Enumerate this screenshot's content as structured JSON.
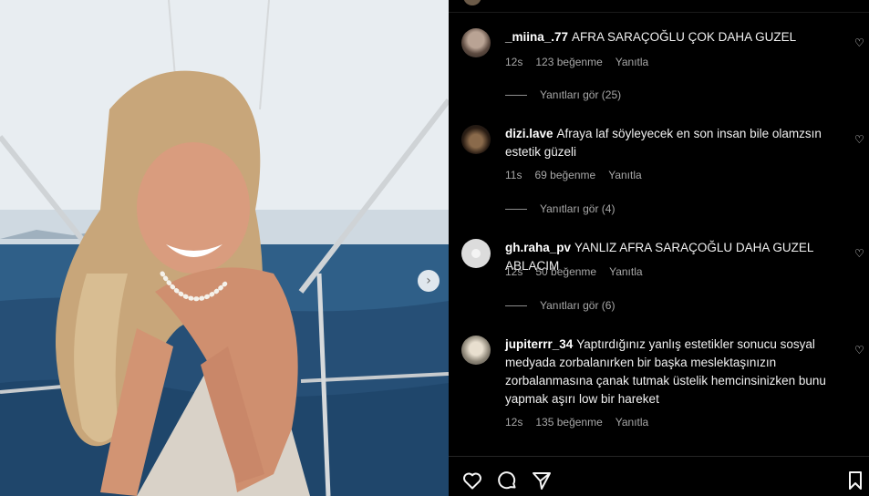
{
  "comments": [
    {
      "username": "_miina_.77",
      "text": "AFRA SARAÇOĞLU ÇOK DAHA GUZEL",
      "time": "12s",
      "likes": "123 beğenme",
      "reply": "Yanıtla",
      "view_replies": "Yanıtları gör (25)"
    },
    {
      "username": "dizi.lave",
      "text": "Afraya laf söyleyecek en son insan bile olamzsın estetik güzeli",
      "time": "11s",
      "likes": "69 beğenme",
      "reply": "Yanıtla",
      "view_replies": "Yanıtları gör (4)"
    },
    {
      "username": "gh.raha_pv",
      "text": "YANLIZ AFRA SARAÇOĞLU DAHA GUZEL ABLACIM",
      "time": "12s",
      "likes": "50 beğenme",
      "reply": "Yanıtla",
      "view_replies": "Yanıtları gör (6)"
    },
    {
      "username": "jupiterrr_34",
      "text": "Yaptırdığınız yanlış estetikler sonucu sosyal medyada zorbalanırken bir başka meslektaşınızın zorbalanmasına çanak tutmak üstelik hemcinsinizken bunu yapmak aşırı low bir hareket",
      "time": "12s",
      "likes": "135 beğenme",
      "reply": "Yanıtla"
    }
  ],
  "icons": {
    "like": "heart-icon",
    "comment": "comment-icon",
    "share": "send-icon",
    "save": "bookmark-icon",
    "carousel": "chevron-right-icon"
  }
}
